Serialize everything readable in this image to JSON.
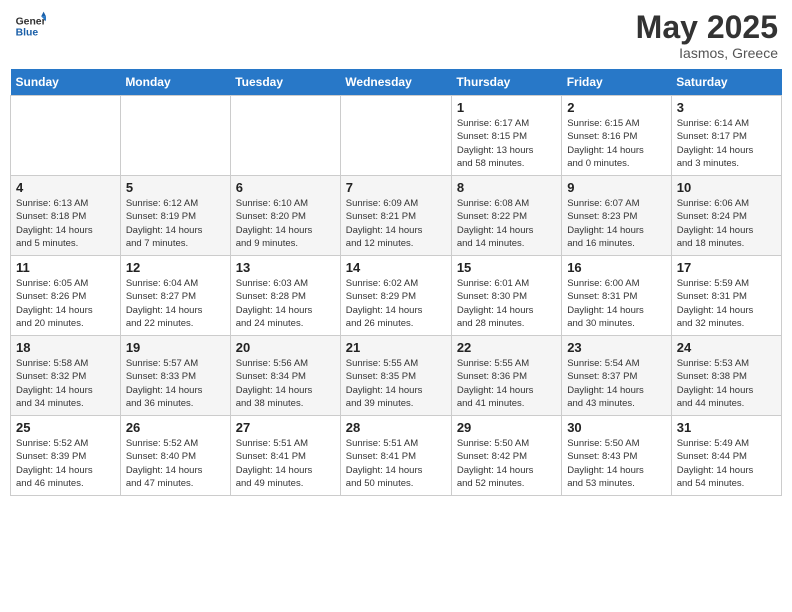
{
  "header": {
    "logo_line1": "General",
    "logo_line2": "Blue",
    "month": "May 2025",
    "location": "Iasmos, Greece"
  },
  "weekdays": [
    "Sunday",
    "Monday",
    "Tuesday",
    "Wednesday",
    "Thursday",
    "Friday",
    "Saturday"
  ],
  "weeks": [
    [
      {
        "day": "",
        "info": ""
      },
      {
        "day": "",
        "info": ""
      },
      {
        "day": "",
        "info": ""
      },
      {
        "day": "",
        "info": ""
      },
      {
        "day": "1",
        "info": "Sunrise: 6:17 AM\nSunset: 8:15 PM\nDaylight: 13 hours\nand 58 minutes."
      },
      {
        "day": "2",
        "info": "Sunrise: 6:15 AM\nSunset: 8:16 PM\nDaylight: 14 hours\nand 0 minutes."
      },
      {
        "day": "3",
        "info": "Sunrise: 6:14 AM\nSunset: 8:17 PM\nDaylight: 14 hours\nand 3 minutes."
      }
    ],
    [
      {
        "day": "4",
        "info": "Sunrise: 6:13 AM\nSunset: 8:18 PM\nDaylight: 14 hours\nand 5 minutes."
      },
      {
        "day": "5",
        "info": "Sunrise: 6:12 AM\nSunset: 8:19 PM\nDaylight: 14 hours\nand 7 minutes."
      },
      {
        "day": "6",
        "info": "Sunrise: 6:10 AM\nSunset: 8:20 PM\nDaylight: 14 hours\nand 9 minutes."
      },
      {
        "day": "7",
        "info": "Sunrise: 6:09 AM\nSunset: 8:21 PM\nDaylight: 14 hours\nand 12 minutes."
      },
      {
        "day": "8",
        "info": "Sunrise: 6:08 AM\nSunset: 8:22 PM\nDaylight: 14 hours\nand 14 minutes."
      },
      {
        "day": "9",
        "info": "Sunrise: 6:07 AM\nSunset: 8:23 PM\nDaylight: 14 hours\nand 16 minutes."
      },
      {
        "day": "10",
        "info": "Sunrise: 6:06 AM\nSunset: 8:24 PM\nDaylight: 14 hours\nand 18 minutes."
      }
    ],
    [
      {
        "day": "11",
        "info": "Sunrise: 6:05 AM\nSunset: 8:26 PM\nDaylight: 14 hours\nand 20 minutes."
      },
      {
        "day": "12",
        "info": "Sunrise: 6:04 AM\nSunset: 8:27 PM\nDaylight: 14 hours\nand 22 minutes."
      },
      {
        "day": "13",
        "info": "Sunrise: 6:03 AM\nSunset: 8:28 PM\nDaylight: 14 hours\nand 24 minutes."
      },
      {
        "day": "14",
        "info": "Sunrise: 6:02 AM\nSunset: 8:29 PM\nDaylight: 14 hours\nand 26 minutes."
      },
      {
        "day": "15",
        "info": "Sunrise: 6:01 AM\nSunset: 8:30 PM\nDaylight: 14 hours\nand 28 minutes."
      },
      {
        "day": "16",
        "info": "Sunrise: 6:00 AM\nSunset: 8:31 PM\nDaylight: 14 hours\nand 30 minutes."
      },
      {
        "day": "17",
        "info": "Sunrise: 5:59 AM\nSunset: 8:31 PM\nDaylight: 14 hours\nand 32 minutes."
      }
    ],
    [
      {
        "day": "18",
        "info": "Sunrise: 5:58 AM\nSunset: 8:32 PM\nDaylight: 14 hours\nand 34 minutes."
      },
      {
        "day": "19",
        "info": "Sunrise: 5:57 AM\nSunset: 8:33 PM\nDaylight: 14 hours\nand 36 minutes."
      },
      {
        "day": "20",
        "info": "Sunrise: 5:56 AM\nSunset: 8:34 PM\nDaylight: 14 hours\nand 38 minutes."
      },
      {
        "day": "21",
        "info": "Sunrise: 5:55 AM\nSunset: 8:35 PM\nDaylight: 14 hours\nand 39 minutes."
      },
      {
        "day": "22",
        "info": "Sunrise: 5:55 AM\nSunset: 8:36 PM\nDaylight: 14 hours\nand 41 minutes."
      },
      {
        "day": "23",
        "info": "Sunrise: 5:54 AM\nSunset: 8:37 PM\nDaylight: 14 hours\nand 43 minutes."
      },
      {
        "day": "24",
        "info": "Sunrise: 5:53 AM\nSunset: 8:38 PM\nDaylight: 14 hours\nand 44 minutes."
      }
    ],
    [
      {
        "day": "25",
        "info": "Sunrise: 5:52 AM\nSunset: 8:39 PM\nDaylight: 14 hours\nand 46 minutes."
      },
      {
        "day": "26",
        "info": "Sunrise: 5:52 AM\nSunset: 8:40 PM\nDaylight: 14 hours\nand 47 minutes."
      },
      {
        "day": "27",
        "info": "Sunrise: 5:51 AM\nSunset: 8:41 PM\nDaylight: 14 hours\nand 49 minutes."
      },
      {
        "day": "28",
        "info": "Sunrise: 5:51 AM\nSunset: 8:41 PM\nDaylight: 14 hours\nand 50 minutes."
      },
      {
        "day": "29",
        "info": "Sunrise: 5:50 AM\nSunset: 8:42 PM\nDaylight: 14 hours\nand 52 minutes."
      },
      {
        "day": "30",
        "info": "Sunrise: 5:50 AM\nSunset: 8:43 PM\nDaylight: 14 hours\nand 53 minutes."
      },
      {
        "day": "31",
        "info": "Sunrise: 5:49 AM\nSunset: 8:44 PM\nDaylight: 14 hours\nand 54 minutes."
      }
    ]
  ]
}
